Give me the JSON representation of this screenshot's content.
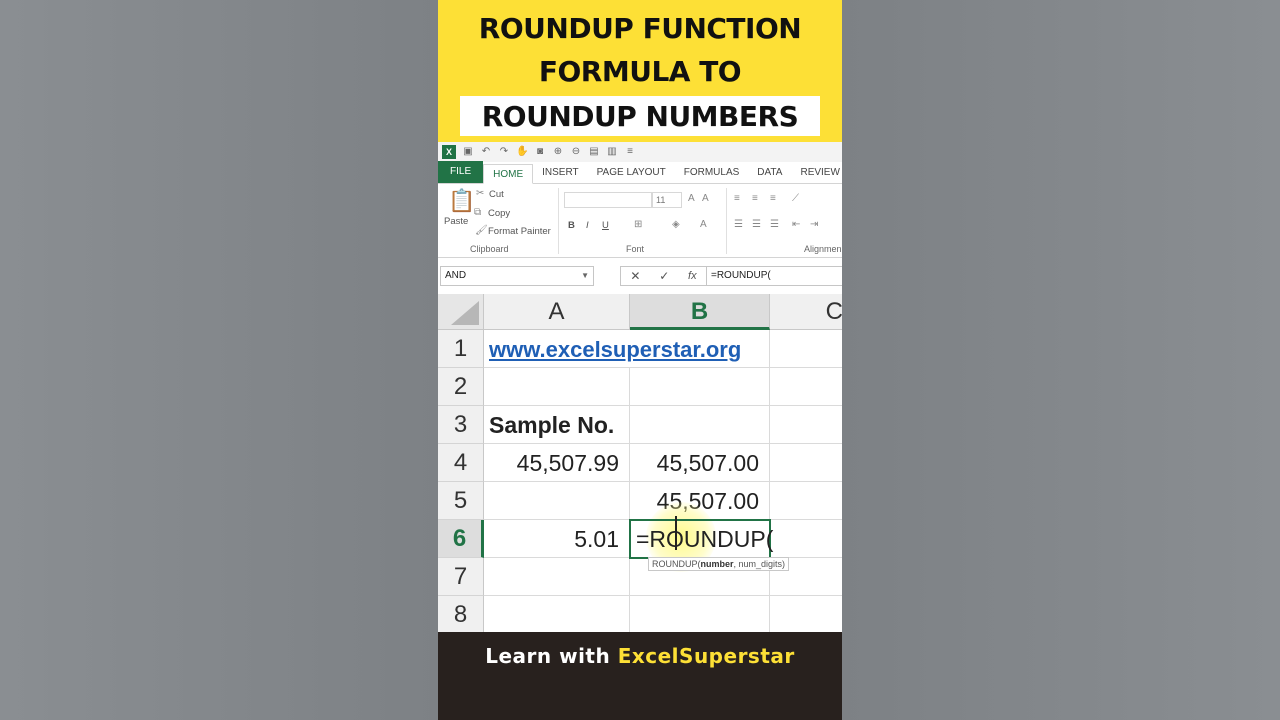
{
  "banner": {
    "line1": "ROUNDUP FUNCTION",
    "line2": "FORMULA TO",
    "line3": "ROUNDUP NUMBERS"
  },
  "ribbon": {
    "tabs": [
      "FILE",
      "HOME",
      "INSERT",
      "PAGE LAYOUT",
      "FORMULAS",
      "DATA",
      "REVIEW"
    ],
    "active_tab": "HOME",
    "clipboard": {
      "paste": "Paste",
      "cut": "Cut",
      "copy": "Copy",
      "format_painter": "Format Painter",
      "label": "Clipboard"
    },
    "font": {
      "size": "11",
      "bold": "B",
      "italic": "I",
      "underline": "U",
      "label": "Font"
    },
    "alignment_label": "Alignmen"
  },
  "formula_bar": {
    "name_box": "AND",
    "cancel": "✕",
    "enter": "✓",
    "fx": "fx",
    "content": "=ROUNDUP("
  },
  "grid": {
    "columns": [
      "A",
      "B",
      "C"
    ],
    "selected_column": "B",
    "rows": [
      "1",
      "2",
      "3",
      "4",
      "5",
      "6",
      "7",
      "8"
    ],
    "selected_row": "6",
    "cells": {
      "A1": "www.excelsuperstar.org",
      "A3": "Sample No.",
      "A4": "45,507.99",
      "B4": "45,507.00",
      "B5": "45,507.00",
      "A6": "5.01",
      "B6": "=ROUNDUP("
    },
    "tooltip": {
      "func": "ROUNDUP(",
      "arg1": "number",
      "rest": ", num_digits)"
    }
  },
  "footer": {
    "prefix": "Learn with ",
    "brand": "ExcelSuperstar"
  },
  "colors": {
    "banner_yellow": "#fde036",
    "excel_green": "#217346",
    "link_blue": "#1f5fb5",
    "footer_bg": "#28211e"
  }
}
